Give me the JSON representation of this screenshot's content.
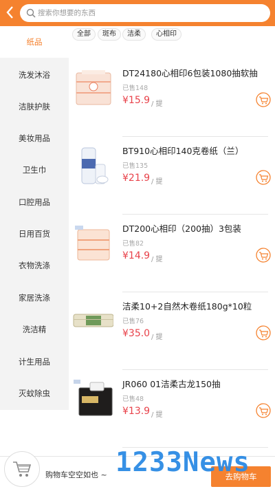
{
  "header": {
    "search_placeholder": "搜索你想要的东西",
    "accent": "#f5822f"
  },
  "sidebar": {
    "items": [
      {
        "label": "纸品",
        "active": true
      },
      {
        "label": "洗发沐浴"
      },
      {
        "label": "洁肤护肤"
      },
      {
        "label": "美妆用品"
      },
      {
        "label": "卫生巾"
      },
      {
        "label": "口腔用品"
      },
      {
        "label": "日用百货"
      },
      {
        "label": "衣物洗涤"
      },
      {
        "label": "家居洗涤"
      },
      {
        "label": "洗洁精"
      },
      {
        "label": "计生用品"
      },
      {
        "label": "灭蚊除虫"
      }
    ]
  },
  "filters": {
    "tabs": [
      "全部",
      "斑布",
      "洁柔",
      "心相印"
    ]
  },
  "products": [
    {
      "title": "DT24180心相印6包装1080抽软抽",
      "sold": "已售148",
      "price": "¥15.9",
      "unit": "/ 提"
    },
    {
      "title": "BT910心相印140克卷纸（兰）",
      "sold": "已售135",
      "price": "¥21.9",
      "unit": "/ 提"
    },
    {
      "title": "DT200心相印（200抽）3包装",
      "sold": "已售82",
      "price": "¥14.9",
      "unit": "/ 提"
    },
    {
      "title": "洁柔10+2自然木卷纸180g*10粒",
      "sold": "已售76",
      "price": "¥35.0",
      "unit": "/ 提"
    },
    {
      "title": "JR060 01洁柔古龙150抽",
      "sold": "已售48",
      "price": "¥13.9",
      "unit": "/ 提"
    }
  ],
  "bottom_bar": {
    "cart_status": "购物车空空如也 ~",
    "checkout_label": "去购物车"
  },
  "watermark": "1233News",
  "colors": {
    "accent": "#f5822f",
    "price": "#e8424a",
    "watermark": "#2c8be4"
  }
}
